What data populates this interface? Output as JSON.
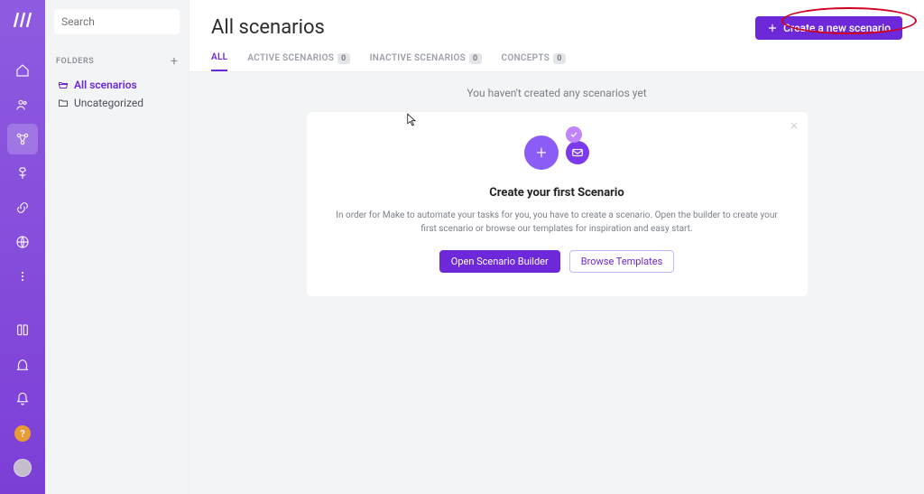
{
  "search": {
    "placeholder": "Search"
  },
  "folders": {
    "header": "FOLDERS",
    "items": [
      {
        "label": "All scenarios"
      },
      {
        "label": "Uncategorized"
      }
    ]
  },
  "page": {
    "title": "All scenarios",
    "create_button": "Create a new scenario"
  },
  "tabs": {
    "all": "ALL",
    "active": {
      "label": "ACTIVE SCENARIOS",
      "badge": "0"
    },
    "inactive": {
      "label": "INACTIVE SCENARIOS",
      "badge": "0"
    },
    "concepts": {
      "label": "CONCEPTS",
      "badge": "0"
    }
  },
  "content": {
    "empty_msg": "You haven't created any scenarios yet",
    "card": {
      "title": "Create your first Scenario",
      "desc": "In order for Make to automate your tasks for you, you have to create a scenario. Open the builder to create your first scenario or browse our templates for inspiration and easy start.",
      "open_builder": "Open Scenario Builder",
      "browse_templates": "Browse Templates"
    }
  },
  "nav_icons": {
    "home": "home-icon",
    "users": "users-icon",
    "scenarios": "scenarios-icon",
    "apps": "apps-icon",
    "connections": "connections-icon",
    "webhooks": "webhooks-icon",
    "more": "more-icon",
    "book": "book-icon",
    "rocket": "rocket-icon",
    "bell": "bell-icon"
  },
  "colors": {
    "brand": "#6d28d9",
    "accent": "#8b5cf6",
    "panel_bg": "#f3f4f6",
    "highlight_ring": "#d00020"
  }
}
